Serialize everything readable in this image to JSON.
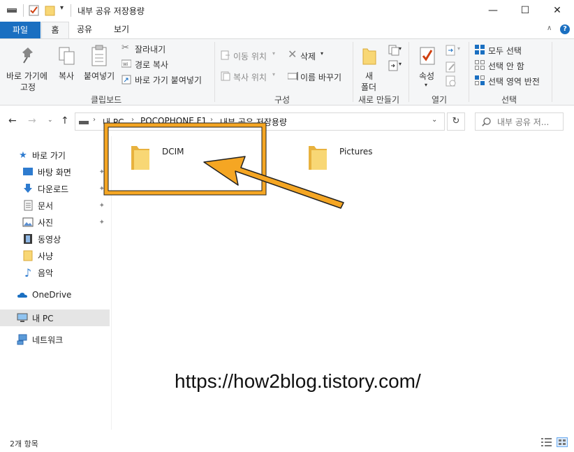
{
  "window": {
    "title": "내부 공유 저장용량",
    "controls": {
      "minimize": "—",
      "maximize": "☐",
      "close": "✕"
    }
  },
  "ribbon_tabs": [
    "파일",
    "홈",
    "공유",
    "보기"
  ],
  "ribbon": {
    "clipboard": {
      "pin_label_1": "바로 가기에",
      "pin_label_2": "고정",
      "copy": "복사",
      "paste": "붙여넣기",
      "cut": "잘라내기",
      "copy_path": "경로 복사",
      "paste_shortcut": "바로 가기 붙여넣기",
      "group": "클립보드"
    },
    "organize": {
      "move_to": "이동 위치",
      "copy_to": "복사 위치",
      "delete": "삭제",
      "rename": "이름 바꾸기",
      "group": "구성"
    },
    "new": {
      "new_folder_1": "새",
      "new_folder_2": "폴더",
      "group": "새로 만들기"
    },
    "open": {
      "properties": "속성",
      "group": "열기"
    },
    "select": {
      "select_all": "모두 선택",
      "select_none": "선택 안 함",
      "invert": "선택 영역 반전",
      "group": "선택"
    }
  },
  "address_bar": {
    "crumbs": [
      "내 PC",
      "POCOPHONE F1",
      "내부 공유 저장용량"
    ],
    "search_placeholder": "내부 공유 저..."
  },
  "nav_pane": {
    "quick_access": "바로 가기",
    "items": [
      "바탕 화면",
      "다운로드",
      "문서",
      "사진",
      "동영상",
      "사냥",
      "음악"
    ],
    "onedrive": "OneDrive",
    "this_pc": "내 PC",
    "network": "네트워크"
  },
  "content": {
    "folders": [
      "DCIM",
      "Pictures"
    ],
    "watermark": "https://how2blog.tistory.com/"
  },
  "status_bar": {
    "count": "2개 항목"
  },
  "colors": {
    "accent": "#1a6fc1",
    "highlight": "#f5a623",
    "folder": "#f8d775"
  }
}
